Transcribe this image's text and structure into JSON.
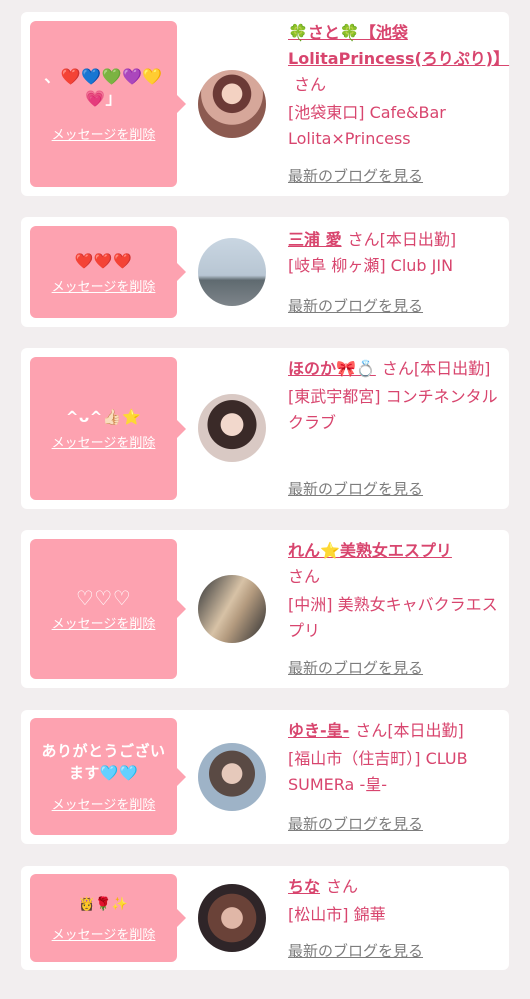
{
  "entries": [
    {
      "message": "、❤️💙💚💜💛💗」",
      "delete_label": "メッセージを削除",
      "name": "🍀さと🍀【池袋LolitaPrincess(ろりぷり)】",
      "san": "さん",
      "status": "",
      "shop": "[池袋東口] Cafe&Bar Lolita×Princess",
      "blog_label": "最新のブログを見る",
      "avatar_icon": "profile-photo"
    },
    {
      "message": "❤️❤️❤️",
      "delete_label": "メッセージを削除",
      "name": "三浦 愛",
      "san": "さん",
      "status": "[本日出勤]",
      "shop": "[岐阜 柳ヶ瀬] Club JIN",
      "blog_label": "最新のブログを見る",
      "avatar_icon": "profile-photo"
    },
    {
      "message": "^ᴗ^👍🏻⭐",
      "delete_label": "メッセージを削除",
      "name": "ほのか🎀💍",
      "san": "さん",
      "status": "[本日出勤]",
      "shop": "[東武宇都宮] コンチネンタルクラブ",
      "blog_label": "最新のブログを見る",
      "avatar_icon": "profile-photo"
    },
    {
      "message": "♡♡♡",
      "delete_label": "メッセージを削除",
      "name": "れん⭐美熟女エスプリ",
      "san": "さん",
      "status": "",
      "shop": "[中洲] 美熟女キャバクラエスプリ",
      "blog_label": "最新のブログを見る",
      "avatar_icon": "profile-photo"
    },
    {
      "message": "ありがとうございます🩵🩵",
      "delete_label": "メッセージを削除",
      "name": "ゆき-皇-",
      "san": "さん",
      "status": "[本日出勤]",
      "shop": "[福山市（住吉町）] CLUB SUMERa -皇-",
      "blog_label": "最新のブログを見る",
      "avatar_icon": "profile-photo"
    },
    {
      "message": "👸🌹✨",
      "delete_label": "メッセージを削除",
      "name": "ちな",
      "san": "さん",
      "status": "",
      "shop": "[松山市] 錦華",
      "blog_label": "最新のブログを見る",
      "avatar_icon": "profile-photo"
    }
  ]
}
